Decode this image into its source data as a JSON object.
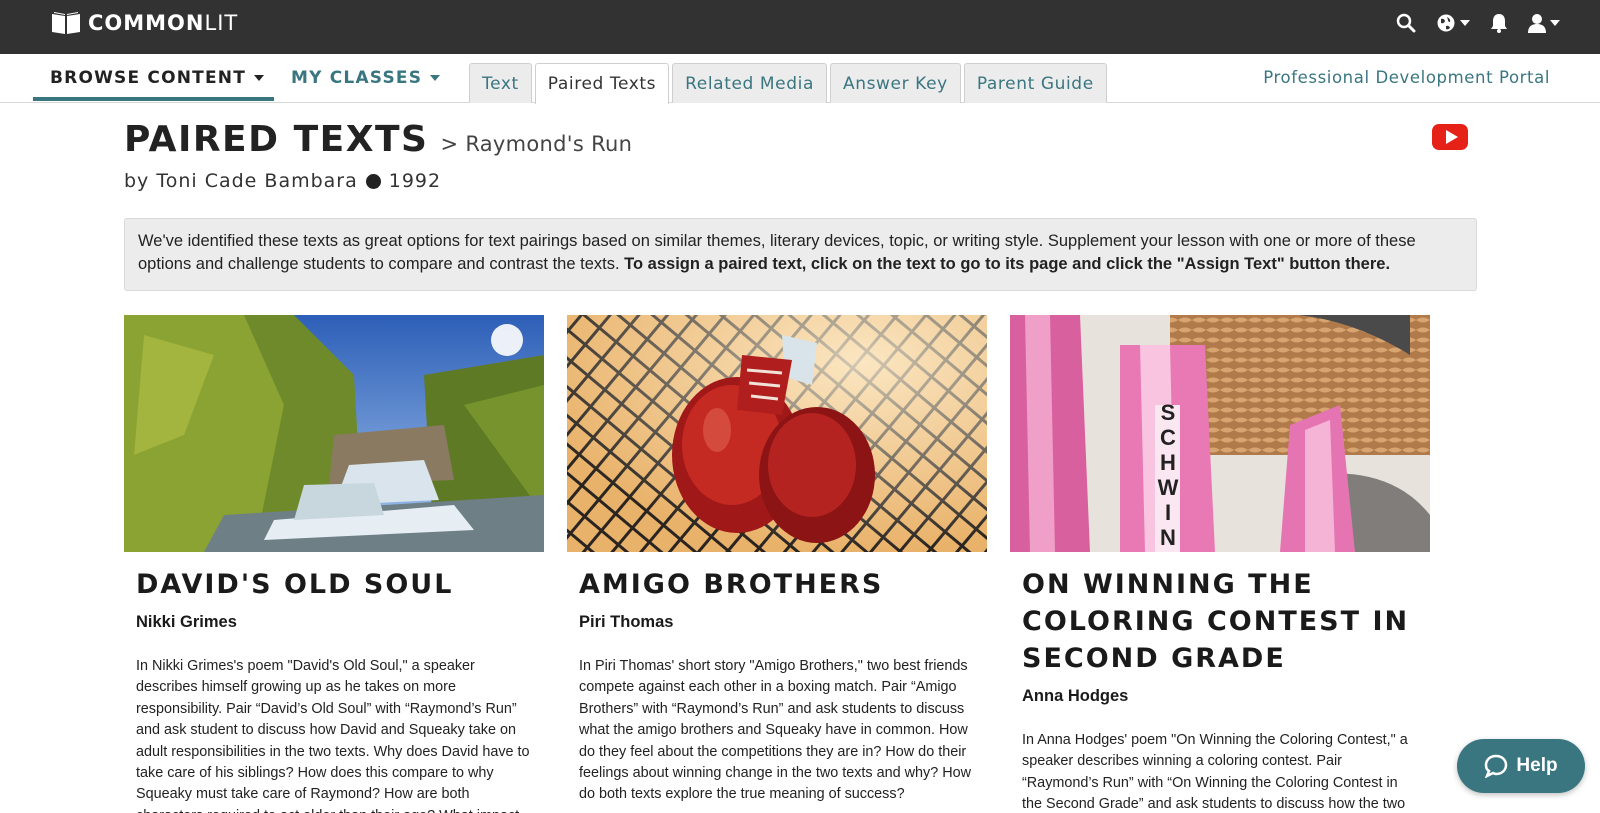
{
  "header": {
    "logo_bold": "COMMON",
    "logo_light": "LIT",
    "icons": [
      "search-icon",
      "globe-icon",
      "bell-icon",
      "user-icon"
    ]
  },
  "nav": {
    "browse_content": "BROWSE CONTENT",
    "my_classes": "MY CLASSES",
    "tabs": [
      {
        "label": "Text",
        "active": false
      },
      {
        "label": "Paired Texts",
        "active": true
      },
      {
        "label": "Related Media",
        "active": false
      },
      {
        "label": "Answer Key",
        "active": false
      },
      {
        "label": "Parent Guide",
        "active": false
      }
    ],
    "pd_portal": "Professional Development Portal"
  },
  "page": {
    "title": "PAIRED TEXTS",
    "breadcrumb": "> Raymond's Run",
    "byline_author": "by Toni Cade Bambara",
    "byline_year": "1992"
  },
  "info": {
    "text": "We've identified these texts as great options for text pairings based on similar themes, literary devices, topic, or writing style. Supplement your lesson with one or more of these options and challenge students to compare and contrast the texts. ",
    "bold": "To assign a paired text, click on the text to go to its page and click the \"Assign Text\" button there."
  },
  "cards": [
    {
      "title": "DAVID'S OLD SOUL",
      "author": "Nikki Grimes",
      "description": "In Nikki Grimes's poem \"David's Old Soul,\" a speaker describes himself growing up as he takes on more responsibility. Pair “David’s Old Soul” with “Raymond’s Run” and ask student to discuss how David and Squeaky take on adult responsibilities in the two texts. Why does David have to take care of his siblings? How does this compare to why Squeaky must take care of Raymond? How are both characters required to act older than their age? What impact do these responsibilities have on them?"
    },
    {
      "title": "AMIGO BROTHERS",
      "author": "Piri Thomas",
      "description": "In Piri Thomas' short story \"Amigo Brothers,\" two best friends compete against each other in a boxing match. Pair “Amigo Brothers” with “Raymond’s Run” and ask students to discuss what the amigo brothers and Squeaky have in common. How do they feel about the competitions they are in? How do their feelings about winning change in the two texts and why? How do both texts explore the true meaning of success?"
    },
    {
      "title": "ON WINNING THE COLORING CONTEST IN SECOND GRADE",
      "author": "Anna Hodges",
      "description": "In Anna Hodges' poem \"On Winning the Coloring Contest,\" a speaker describes winning a coloring contest.   Pair “Raymond’s Run” with “On Winning the Coloring Contest in the Second Grade” and ask students to discuss how the two texts explore"
    }
  ],
  "help": {
    "label": "Help"
  },
  "colors": {
    "accent": "#3a7680",
    "topbar": "#323232",
    "youtube": "#e62117"
  }
}
